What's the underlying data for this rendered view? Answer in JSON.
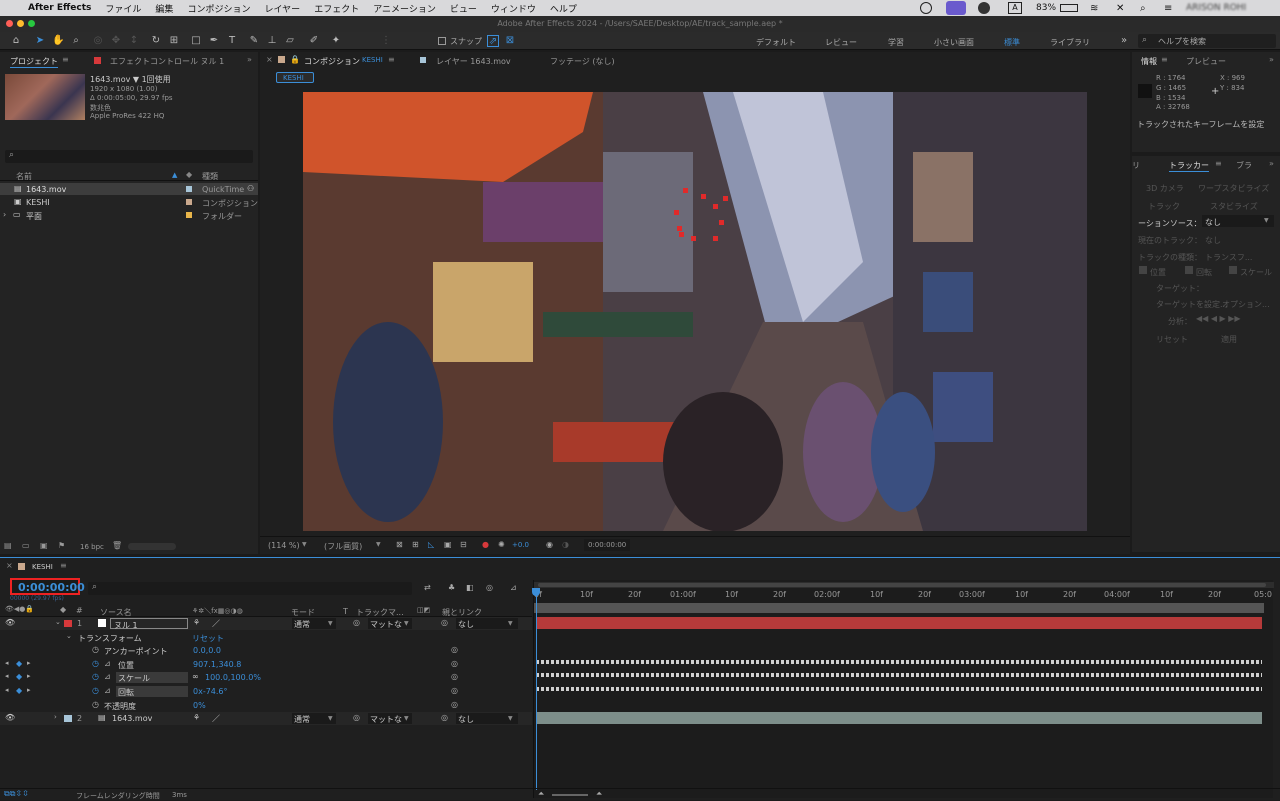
{
  "menubar": {
    "apple": "",
    "app": "After Effects",
    "items": [
      "ファイル",
      "編集",
      "コンポジション",
      "レイヤー",
      "エフェクト",
      "アニメーション",
      "ビュー",
      "ウィンドウ",
      "ヘルプ"
    ],
    "battery": "83%",
    "user": "ARISON ROHI"
  },
  "window": {
    "title": "Adobe After Effects 2024 - /Users/SAEE/Desktop/AE/track_sample.aep *"
  },
  "toolbar": {
    "snap": "スナップ",
    "workspaces": [
      "デフォルト",
      "レビュー",
      "学習",
      "小さい画面",
      "標準",
      "ライブラリ"
    ],
    "help_placeholder": "ヘルプを検索"
  },
  "project": {
    "tab": "プロジェクト",
    "tab2": "エフェクトコントロール ヌル 1",
    "info": [
      "1643.mov ▼ 1回使用",
      "1920 x 1080 (1.00)",
      "Δ 0:00:05:00, 29.97 fps",
      "数兆色",
      "Apple ProRes 422 HQ"
    ],
    "col_name": "名前",
    "col_type": "種類",
    "items": [
      {
        "name": "1643.mov",
        "type": "QuickTime",
        "color": "#a7c5d8"
      },
      {
        "name": "KESHI",
        "type": "コンポジション",
        "color": "#c9a88d"
      },
      {
        "name": "平面",
        "type": "フォルダー",
        "color": "#e8b54a"
      }
    ],
    "bpc": "16 bpc"
  },
  "viewer": {
    "tab": "コンポジション",
    "comp": "KESHI",
    "layer_tab": "レイヤー 1643.mov",
    "footage_tab": "フッテージ (なし)",
    "crumb": "KESHI",
    "zoom": "(114 %)",
    "quality": "(フル画質)",
    "offset": "+0.0",
    "timecode": "0:00:00:00"
  },
  "info": {
    "tab": "情報",
    "tab2": "プレビュー",
    "R": "R : 1764",
    "G": "G : 1465",
    "B": "B : 1534",
    "A": "A : 32768",
    "X": "X : 969",
    "Y": "Y : 834",
    "msg": "トラックされたキーフレームを設定"
  },
  "tracker": {
    "tab_left": "リ",
    "tab": "トラッカー",
    "tab_right": "ブラ",
    "btn1": "3D カメラ",
    "btn2": "ワープスタビライズ",
    "btn3": "トラック",
    "btn4": "スタビライズ",
    "source_label": "ーションソース：",
    "source_val": "なし",
    "current_label": "現在のトラック：",
    "current_val": "なし",
    "type_label": "トラックの種類：",
    "type_val": "トランスフ...",
    "cb_pos": "位置",
    "cb_rot": "回転",
    "cb_scale": "スケール",
    "target": "ターゲット：",
    "set_target": "ターゲットを設定...",
    "options": "オプション...",
    "analyze": "分析：",
    "reset": "リセット",
    "apply": "適用"
  },
  "timeline": {
    "tab": "KESHI",
    "timecode": "0:00:00:00",
    "fps": "00000 (29.97 fps)",
    "headers": {
      "source": "ソース名",
      "mode": "モード",
      "t": "T",
      "track": "トラックマ...",
      "parent": "親とリンク"
    },
    "layers": [
      {
        "num": "1",
        "name": "ヌル 1",
        "mode": "通常",
        "matte": "マットな",
        "parent": "なし",
        "color": "#d7393b"
      },
      {
        "num": "2",
        "name": "1643.mov",
        "mode": "通常",
        "matte": "マットな",
        "parent": "なし",
        "color": "#a7c5d8"
      }
    ],
    "transform": "トランスフォーム",
    "reset": "リセット",
    "props": [
      {
        "name": "アンカーポイント",
        "value": "0.0,0.0"
      },
      {
        "name": "位置",
        "value": "907.1,340.8"
      },
      {
        "name": "スケール",
        "value": "100.0,100.0%"
      },
      {
        "name": "回転",
        "value": "0x-74.6°"
      },
      {
        "name": "不透明度",
        "value": "0%"
      }
    ],
    "ruler": [
      "0f",
      "10f",
      "20f",
      "01:00f",
      "10f",
      "20f",
      "02:00f",
      "10f",
      "20f",
      "03:00f",
      "10f",
      "20f",
      "04:00f",
      "10f",
      "20f",
      "05:0"
    ],
    "footer": "フレームレンダリング時間",
    "render_time": "3ms"
  }
}
